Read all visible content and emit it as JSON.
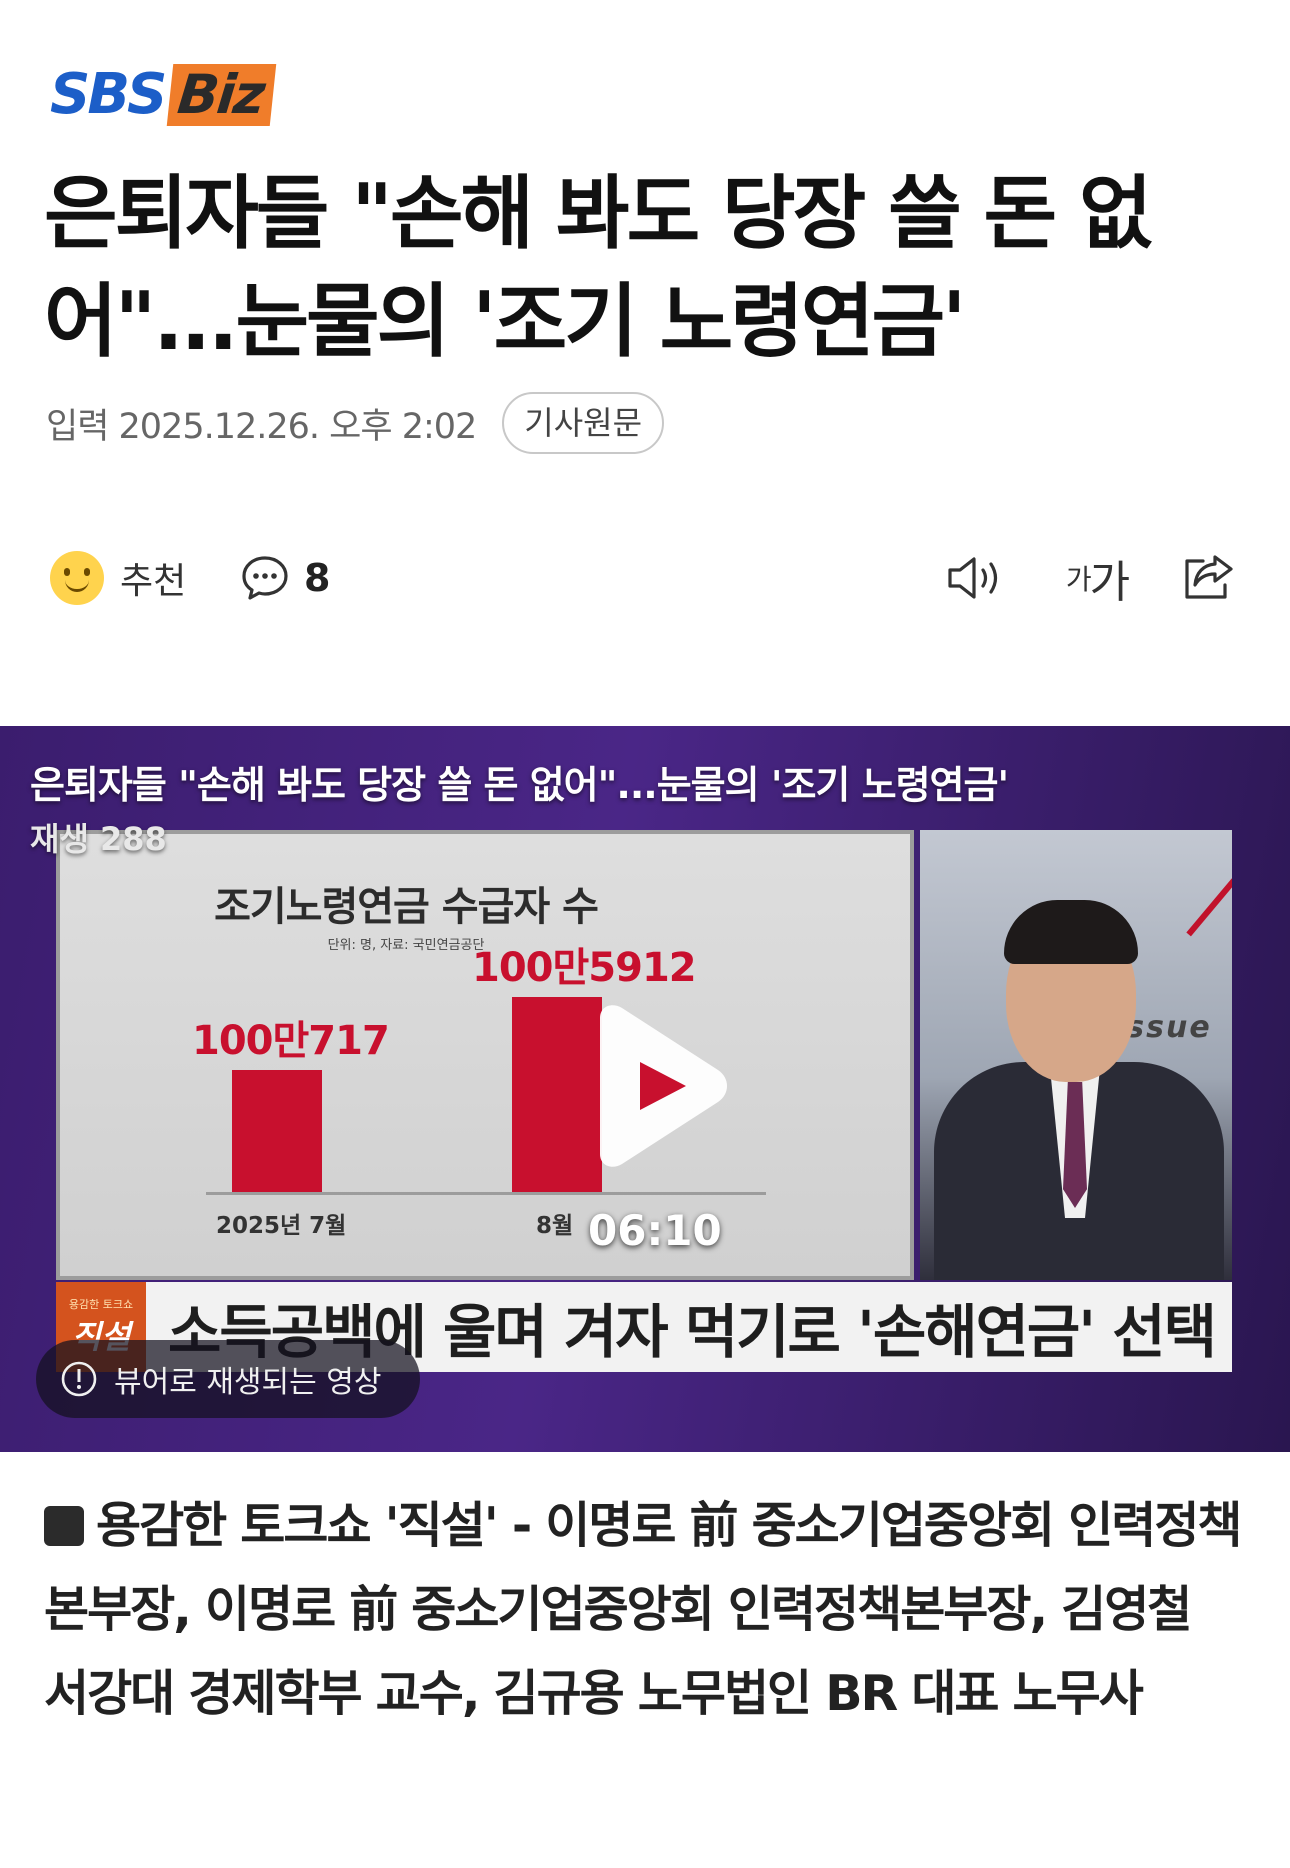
{
  "brand": {
    "part1": "SBS",
    "part2": "Biz"
  },
  "article": {
    "headline": "은퇴자들 \"손해 봐도 당장 쓸 돈 없어\"...눈물의 '조기 노령연금'",
    "date": "입력 2025.12.26. 오후 2:02",
    "original_link": "기사원문"
  },
  "actions": {
    "recommend_label": "추천",
    "comment_count": "8",
    "font_small": "가",
    "font_big": "가"
  },
  "video": {
    "title": "은퇴자들 \"손해 봐도 당장 쓸 돈 없어\"...눈물의 '조기 노령연금'",
    "views": "재생 288",
    "duration": "06:10",
    "viewer_notice": "뷰어로 재생되는 영상",
    "host_backdrop_text": "issue",
    "lower_third_badge_small": "용감한 토크쇼",
    "lower_third_badge": "직설",
    "lower_third_text": "소득공백에 울며 겨자 먹기로 '손해연금' 선택"
  },
  "chart_data": {
    "type": "bar",
    "title": "조기노령연금 수급자 수",
    "subtitle": "단위: 명, 자료: 국민연금공단",
    "categories": [
      "2025년 7월",
      "8월"
    ],
    "values": [
      1000717,
      1005912
    ],
    "value_labels": [
      "100만717",
      "100만5912"
    ],
    "ylim": [
      992000,
      1007000
    ]
  },
  "caption": "용감한 토크쇼 '직설' - 이명로 前 중소기업중앙회 인력정책본부장, 이명로 前 중소기업중앙회 인력정책본부장, 김영철 서강대 경제학부 교수, 김규용 노무법인 BR 대표 노무사",
  "colors": {
    "brand_blue": "#1c5ec8",
    "brand_orange": "#f07d2a",
    "bar_red": "#c8102e",
    "video_purple": "#4a2687"
  }
}
